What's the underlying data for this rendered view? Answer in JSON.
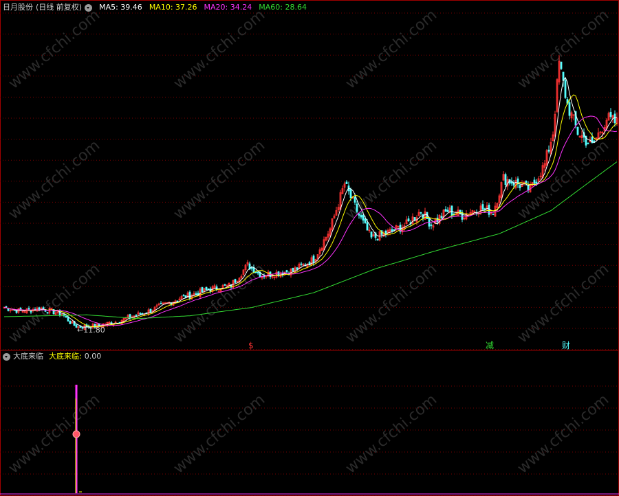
{
  "header": {
    "stock": "日月股份",
    "period": "(日线 前复权)",
    "ma": [
      {
        "label": "MA5:",
        "value": "39.46",
        "color": "#ffffff"
      },
      {
        "label": "MA10:",
        "value": "37.26",
        "color": "#ffff00"
      },
      {
        "label": "MA20:",
        "value": "34.24",
        "color": "#ff33ff"
      },
      {
        "label": "MA60:",
        "value": "28.64",
        "color": "#33dd33"
      }
    ]
  },
  "indicator": {
    "name": "大底来临",
    "value_label": "大底来临:",
    "value": "0.00",
    "color": "#ffff00"
  },
  "watermark": "www.cfchi.com",
  "colors": {
    "up": "#ff3333",
    "down": "#55ffff",
    "grid": "#7a0000",
    "border": "#a00000",
    "ma5": "#ffffff",
    "ma10": "#ffff00",
    "ma20": "#ff33ff",
    "ma60": "#33dd33",
    "signal": "#ff33ff"
  },
  "chart_data": [
    {
      "type": "candlestick",
      "title": "日月股份 (日线 前复权)",
      "ylim": [
        9.5,
        46
      ],
      "low_marker": "11.80",
      "event_markers": [
        {
          "label": "$",
          "index": 120,
          "color": "#ff3333"
        },
        {
          "label": "减",
          "index": 235,
          "color": "#33dd33"
        },
        {
          "label": "财",
          "index": 272,
          "color": "#55ffff"
        }
      ],
      "ohlc_keypoints": [
        [
          0,
          14.0
        ],
        [
          8,
          13.6
        ],
        [
          18,
          13.9
        ],
        [
          28,
          13.3
        ],
        [
          33,
          12.2
        ],
        [
          36,
          11.9
        ],
        [
          45,
          12.0
        ],
        [
          55,
          12.5
        ],
        [
          70,
          13.6
        ],
        [
          85,
          15.0
        ],
        [
          100,
          16.0
        ],
        [
          110,
          16.4
        ],
        [
          118,
          18.6
        ],
        [
          125,
          17.5
        ],
        [
          140,
          18.0
        ],
        [
          150,
          19.2
        ],
        [
          158,
          22.5
        ],
        [
          165,
          27.4
        ],
        [
          172,
          24.0
        ],
        [
          178,
          21.5
        ],
        [
          185,
          22.0
        ],
        [
          195,
          23.0
        ],
        [
          202,
          24.5
        ],
        [
          207,
          23.0
        ],
        [
          215,
          24.5
        ],
        [
          222,
          24.0
        ],
        [
          230,
          24.8
        ],
        [
          237,
          24.4
        ],
        [
          242,
          28.0
        ],
        [
          248,
          27.5
        ],
        [
          255,
          26.8
        ],
        [
          262,
          29.5
        ],
        [
          266,
          33.0
        ],
        [
          269,
          40.5
        ],
        [
          273,
          36.0
        ],
        [
          278,
          33.0
        ],
        [
          285,
          31.5
        ],
        [
          292,
          34.5
        ],
        [
          297,
          34.0
        ]
      ],
      "ma60_keypoints": [
        [
          0,
          13.0
        ],
        [
          40,
          13.2
        ],
        [
          65,
          12.8
        ],
        [
          90,
          13.1
        ],
        [
          120,
          14.0
        ],
        [
          150,
          15.6
        ],
        [
          180,
          18.2
        ],
        [
          210,
          20.2
        ],
        [
          240,
          22.0
        ],
        [
          265,
          24.5
        ],
        [
          280,
          27.0
        ],
        [
          297,
          29.8
        ]
      ]
    },
    {
      "type": "bar",
      "title": "大底来临",
      "ylim": [
        0,
        1
      ],
      "signal_spike": {
        "index": 35,
        "value": 1.0
      },
      "series": [
        {
          "name": "大底来临",
          "values": [
            0.0
          ]
        }
      ]
    }
  ]
}
